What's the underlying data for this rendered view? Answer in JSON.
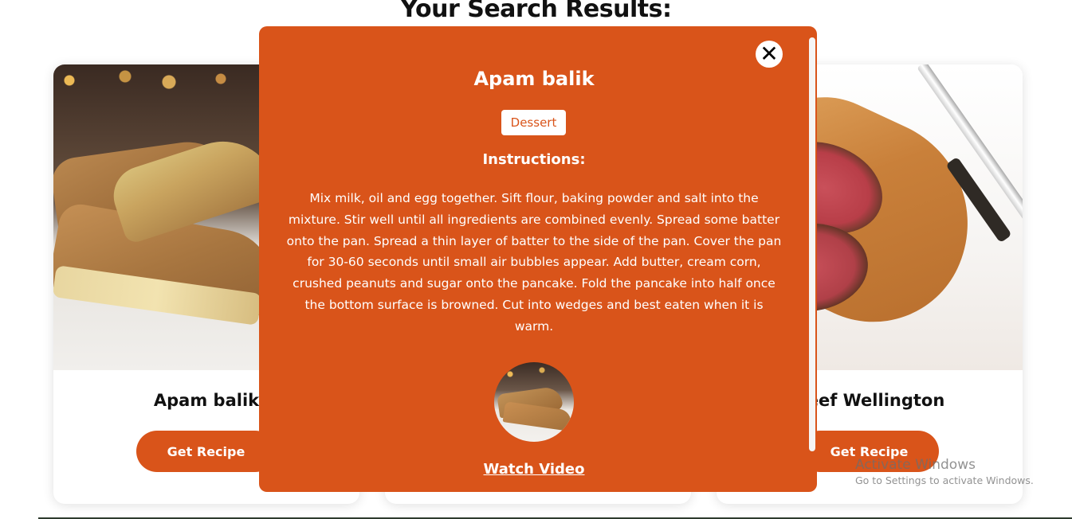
{
  "page": {
    "heading": "Your Search Results:"
  },
  "cards": [
    {
      "title": "Apam balik",
      "button_label": "Get Recipe"
    },
    {
      "title": "",
      "button_label": ""
    },
    {
      "title": "Beef Wellington",
      "button_label": "Get Recipe"
    }
  ],
  "modal": {
    "title": "Apam balik",
    "category": "Dessert",
    "instructions_heading": "Instructions:",
    "instructions": "Mix milk, oil and egg together. Sift flour, baking powder and salt into the mixture. Stir well until all ingredients are combined evenly. Spread some batter onto the pan. Spread a thin layer of batter to the side of the pan. Cover the pan for 30-60 seconds until small air bubbles appear. Add butter, cream corn, crushed peanuts and sugar onto the pancake. Fold the pancake into half once the bottom surface is browned. Cut into wedges and best eaten when it is warm.",
    "video_link": "Watch Video",
    "close_glyph": "✕"
  },
  "watermark": {
    "line1": "Activate Windows",
    "line2": "Go to Settings to activate Windows."
  },
  "colors": {
    "accent": "#d9541a",
    "text_dark": "#111111",
    "white": "#ffffff"
  }
}
